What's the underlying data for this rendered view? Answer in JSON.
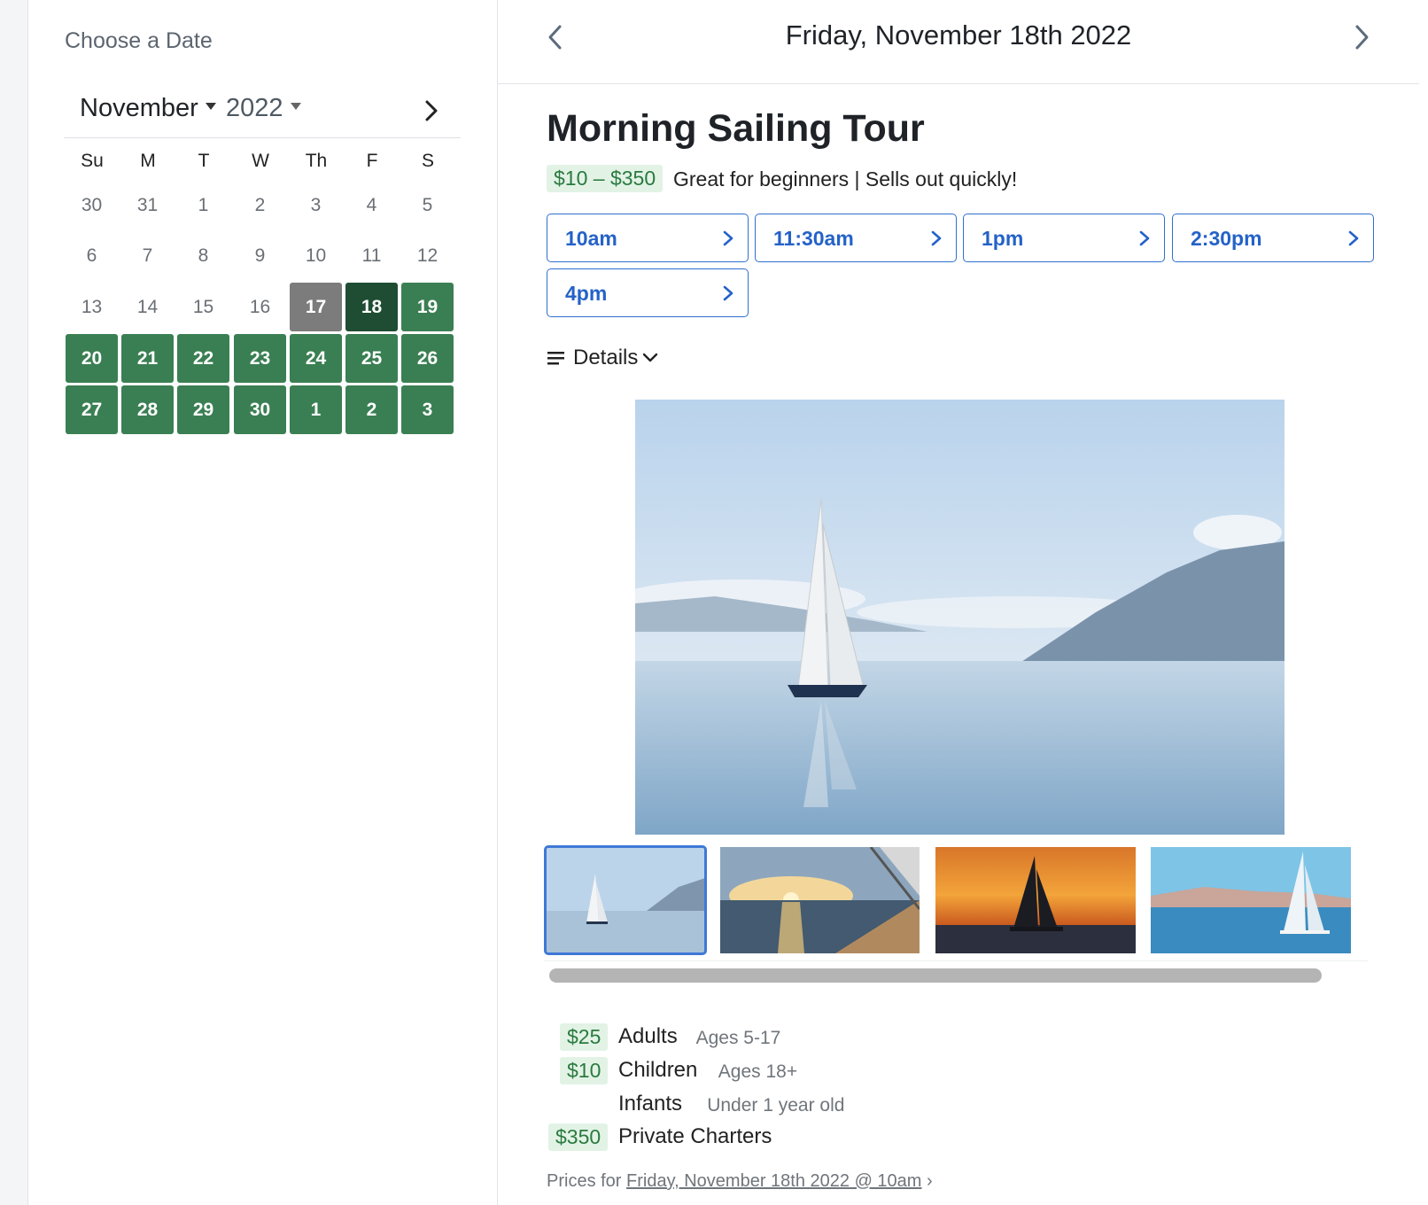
{
  "calendar": {
    "heading": "Choose a Date",
    "month": "November",
    "year": "2022",
    "weekdays": [
      "Su",
      "M",
      "T",
      "W",
      "Th",
      "F",
      "S"
    ],
    "days": [
      {
        "d": "30",
        "s": "muted"
      },
      {
        "d": "31",
        "s": "muted"
      },
      {
        "d": "1",
        "s": "muted"
      },
      {
        "d": "2",
        "s": "muted"
      },
      {
        "d": "3",
        "s": "muted"
      },
      {
        "d": "4",
        "s": "muted"
      },
      {
        "d": "5",
        "s": "muted"
      },
      {
        "d": "6",
        "s": "muted"
      },
      {
        "d": "7",
        "s": "muted"
      },
      {
        "d": "8",
        "s": "muted"
      },
      {
        "d": "9",
        "s": "muted"
      },
      {
        "d": "10",
        "s": "muted"
      },
      {
        "d": "11",
        "s": "muted"
      },
      {
        "d": "12",
        "s": "muted"
      },
      {
        "d": "13",
        "s": "muted"
      },
      {
        "d": "14",
        "s": "muted"
      },
      {
        "d": "15",
        "s": "muted"
      },
      {
        "d": "16",
        "s": "muted"
      },
      {
        "d": "17",
        "s": "today"
      },
      {
        "d": "18",
        "s": "selected"
      },
      {
        "d": "19",
        "s": "avail"
      },
      {
        "d": "20",
        "s": "avail"
      },
      {
        "d": "21",
        "s": "avail"
      },
      {
        "d": "22",
        "s": "avail"
      },
      {
        "d": "23",
        "s": "avail"
      },
      {
        "d": "24",
        "s": "avail"
      },
      {
        "d": "25",
        "s": "avail"
      },
      {
        "d": "26",
        "s": "avail"
      },
      {
        "d": "27",
        "s": "avail"
      },
      {
        "d": "28",
        "s": "avail"
      },
      {
        "d": "29",
        "s": "avail"
      },
      {
        "d": "30",
        "s": "avail"
      },
      {
        "d": "1",
        "s": "avail"
      },
      {
        "d": "2",
        "s": "avail"
      },
      {
        "d": "3",
        "s": "avail"
      }
    ]
  },
  "header": {
    "date_title": "Friday, November 18th 2022"
  },
  "tour": {
    "title": "Morning Sailing Tour",
    "price_range": "$10 – $350",
    "tagline": "Great for beginners | Sells out quickly!",
    "times": [
      "10am",
      "11:30am",
      "1pm",
      "2:30pm",
      "4pm"
    ],
    "details_label": "Details"
  },
  "gallery": {
    "thumbnails": [
      "calm-lake-sailboat",
      "sunset-deck-view",
      "orange-sunset-catamaran",
      "blue-sky-sailboat"
    ]
  },
  "pricing": {
    "rows": [
      {
        "price": "$25",
        "label": "Adults",
        "sub": "Ages 5-17"
      },
      {
        "price": "$10",
        "label": "Children",
        "sub": "Ages 18+"
      },
      {
        "price": "",
        "label": "Infants",
        "sub": "Under 1 year old"
      },
      {
        "price": "$350",
        "label": "Private Charters",
        "sub": ""
      }
    ],
    "prices_for_prefix": "Prices for",
    "prices_for_link": "Friday, November 18th 2022 @ 10am",
    "prices_for_suffix": "›"
  },
  "colors": {
    "available_day": "#3a7f53",
    "selected_day": "#1f4d33",
    "today_day": "#7c7c7c",
    "time_button": "#2462c8",
    "price_badge_bg": "#e2f3e6"
  }
}
